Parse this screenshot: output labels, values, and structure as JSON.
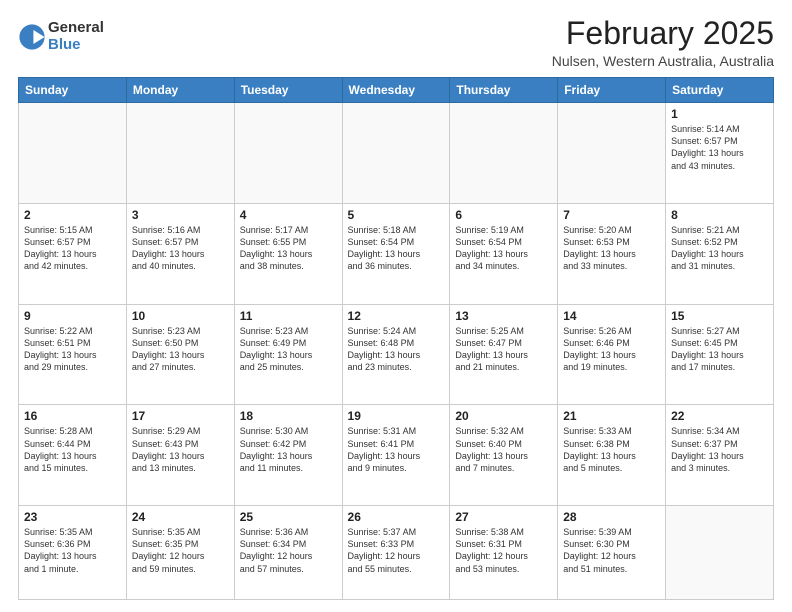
{
  "logo": {
    "general": "General",
    "blue": "Blue"
  },
  "title": "February 2025",
  "location": "Nulsen, Western Australia, Australia",
  "days_of_week": [
    "Sunday",
    "Monday",
    "Tuesday",
    "Wednesday",
    "Thursday",
    "Friday",
    "Saturday"
  ],
  "weeks": [
    [
      {
        "num": "",
        "info": ""
      },
      {
        "num": "",
        "info": ""
      },
      {
        "num": "",
        "info": ""
      },
      {
        "num": "",
        "info": ""
      },
      {
        "num": "",
        "info": ""
      },
      {
        "num": "",
        "info": ""
      },
      {
        "num": "1",
        "info": "Sunrise: 5:14 AM\nSunset: 6:57 PM\nDaylight: 13 hours\nand 43 minutes."
      }
    ],
    [
      {
        "num": "2",
        "info": "Sunrise: 5:15 AM\nSunset: 6:57 PM\nDaylight: 13 hours\nand 42 minutes."
      },
      {
        "num": "3",
        "info": "Sunrise: 5:16 AM\nSunset: 6:57 PM\nDaylight: 13 hours\nand 40 minutes."
      },
      {
        "num": "4",
        "info": "Sunrise: 5:17 AM\nSunset: 6:55 PM\nDaylight: 13 hours\nand 38 minutes."
      },
      {
        "num": "5",
        "info": "Sunrise: 5:18 AM\nSunset: 6:54 PM\nDaylight: 13 hours\nand 36 minutes."
      },
      {
        "num": "6",
        "info": "Sunrise: 5:19 AM\nSunset: 6:54 PM\nDaylight: 13 hours\nand 34 minutes."
      },
      {
        "num": "7",
        "info": "Sunrise: 5:20 AM\nSunset: 6:53 PM\nDaylight: 13 hours\nand 33 minutes."
      },
      {
        "num": "8",
        "info": "Sunrise: 5:21 AM\nSunset: 6:52 PM\nDaylight: 13 hours\nand 31 minutes."
      }
    ],
    [
      {
        "num": "9",
        "info": "Sunrise: 5:22 AM\nSunset: 6:51 PM\nDaylight: 13 hours\nand 29 minutes."
      },
      {
        "num": "10",
        "info": "Sunrise: 5:23 AM\nSunset: 6:50 PM\nDaylight: 13 hours\nand 27 minutes."
      },
      {
        "num": "11",
        "info": "Sunrise: 5:23 AM\nSunset: 6:49 PM\nDaylight: 13 hours\nand 25 minutes."
      },
      {
        "num": "12",
        "info": "Sunrise: 5:24 AM\nSunset: 6:48 PM\nDaylight: 13 hours\nand 23 minutes."
      },
      {
        "num": "13",
        "info": "Sunrise: 5:25 AM\nSunset: 6:47 PM\nDaylight: 13 hours\nand 21 minutes."
      },
      {
        "num": "14",
        "info": "Sunrise: 5:26 AM\nSunset: 6:46 PM\nDaylight: 13 hours\nand 19 minutes."
      },
      {
        "num": "15",
        "info": "Sunrise: 5:27 AM\nSunset: 6:45 PM\nDaylight: 13 hours\nand 17 minutes."
      }
    ],
    [
      {
        "num": "16",
        "info": "Sunrise: 5:28 AM\nSunset: 6:44 PM\nDaylight: 13 hours\nand 15 minutes."
      },
      {
        "num": "17",
        "info": "Sunrise: 5:29 AM\nSunset: 6:43 PM\nDaylight: 13 hours\nand 13 minutes."
      },
      {
        "num": "18",
        "info": "Sunrise: 5:30 AM\nSunset: 6:42 PM\nDaylight: 13 hours\nand 11 minutes."
      },
      {
        "num": "19",
        "info": "Sunrise: 5:31 AM\nSunset: 6:41 PM\nDaylight: 13 hours\nand 9 minutes."
      },
      {
        "num": "20",
        "info": "Sunrise: 5:32 AM\nSunset: 6:40 PM\nDaylight: 13 hours\nand 7 minutes."
      },
      {
        "num": "21",
        "info": "Sunrise: 5:33 AM\nSunset: 6:38 PM\nDaylight: 13 hours\nand 5 minutes."
      },
      {
        "num": "22",
        "info": "Sunrise: 5:34 AM\nSunset: 6:37 PM\nDaylight: 13 hours\nand 3 minutes."
      }
    ],
    [
      {
        "num": "23",
        "info": "Sunrise: 5:35 AM\nSunset: 6:36 PM\nDaylight: 13 hours\nand 1 minute."
      },
      {
        "num": "24",
        "info": "Sunrise: 5:35 AM\nSunset: 6:35 PM\nDaylight: 12 hours\nand 59 minutes."
      },
      {
        "num": "25",
        "info": "Sunrise: 5:36 AM\nSunset: 6:34 PM\nDaylight: 12 hours\nand 57 minutes."
      },
      {
        "num": "26",
        "info": "Sunrise: 5:37 AM\nSunset: 6:33 PM\nDaylight: 12 hours\nand 55 minutes."
      },
      {
        "num": "27",
        "info": "Sunrise: 5:38 AM\nSunset: 6:31 PM\nDaylight: 12 hours\nand 53 minutes."
      },
      {
        "num": "28",
        "info": "Sunrise: 5:39 AM\nSunset: 6:30 PM\nDaylight: 12 hours\nand 51 minutes."
      },
      {
        "num": "",
        "info": ""
      }
    ]
  ]
}
